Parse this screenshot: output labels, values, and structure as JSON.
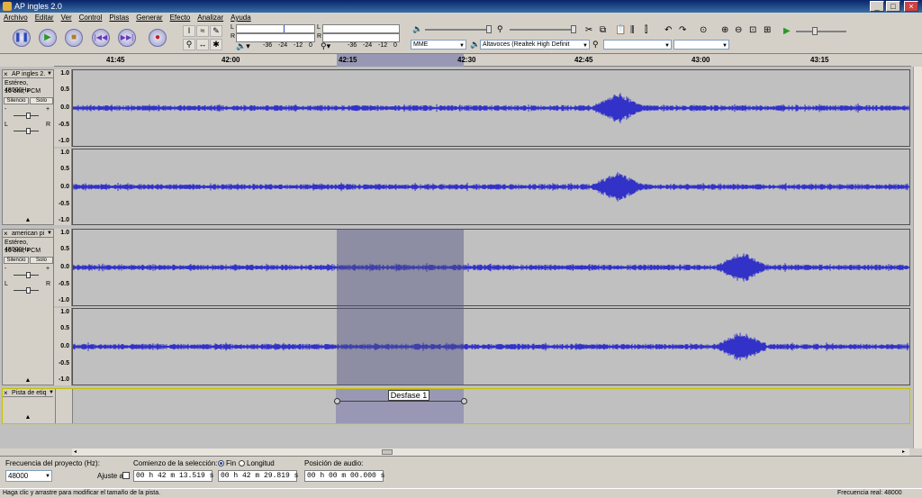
{
  "window": {
    "title": "AP ingles 2.0"
  },
  "menu": [
    "Archivo",
    "Editar",
    "Ver",
    "Control",
    "Pistas",
    "Generar",
    "Efecto",
    "Analizar",
    "Ayuda"
  ],
  "meters": {
    "scale_left": [
      "-36",
      "-24",
      "-12",
      "0"
    ],
    "scale_right": [
      "-36",
      "-24",
      "-12",
      "0"
    ],
    "l": "L",
    "r": "R"
  },
  "devices": {
    "host": "MME",
    "output": "Altavoces (Realtek High Definit",
    "input": "",
    "channels": ""
  },
  "ruler": {
    "ticks": [
      "41:45",
      "42:00",
      "42:15",
      "42:30",
      "42:45",
      "43:00",
      "43:15"
    ]
  },
  "tracks": [
    {
      "name": "AP ingles 2.",
      "info1": "Estéreo, 48000Hz",
      "info2": "16 bits, PCM",
      "mute": "Silencio",
      "solo": "Solo",
      "vscale": [
        "1.0",
        "0.5",
        "0.0",
        "-0.5",
        "-1.0"
      ]
    },
    {
      "name": "american pi",
      "info1": "Estéreo, 48000Hz",
      "info2": "16 bits, PCM",
      "mute": "Silencio",
      "solo": "Solo",
      "vscale": [
        "1.0",
        "0.5",
        "0.0",
        "-0.5",
        "-1.0"
      ]
    }
  ],
  "gain_slider": {
    "minus": "-",
    "plus": "+"
  },
  "pan_slider": {
    "left": "L",
    "right": "R"
  },
  "label_track": {
    "name": "Pista de etiq",
    "label_text": "Desfase 1"
  },
  "bottom": {
    "rate_label": "Frecuencia del proyecto (Hz):",
    "rate_value": "48000",
    "snap_label": "Ajuste a",
    "sel_start_label": "Comienzo de la selección:",
    "end_label": "Fin",
    "length_label": "Longitud",
    "sel_start": "00 h 42 m 13.519 s",
    "sel_end": "00 h 42 m 29.819 s",
    "audio_pos_label": "Posición de audio:",
    "audio_pos": "00 h 00 m 00.000 s"
  },
  "status": {
    "left": "Haga clic y arrastre para modificar el tamaño de la pista.",
    "right": "Frecuencia real: 48000"
  },
  "colors": {
    "waveform": "#3232c8",
    "selection": "#9898b4",
    "label_track_border": "#c8c000"
  }
}
